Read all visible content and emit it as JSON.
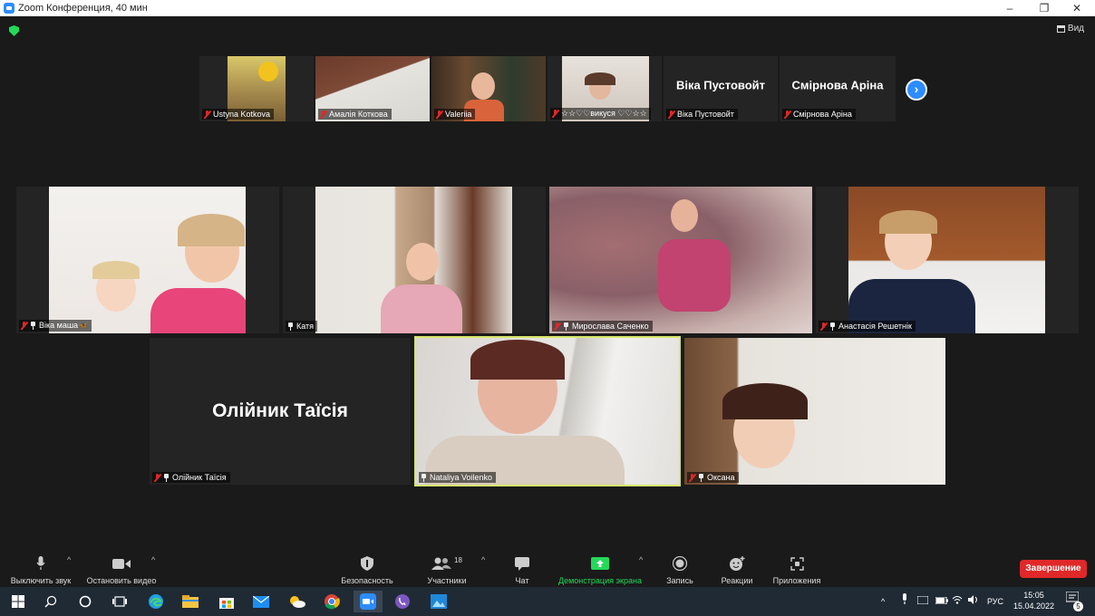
{
  "window": {
    "title": "Zoom Конференция, 40 мин",
    "minimize": "–",
    "maximize": "❐",
    "close": "✕"
  },
  "top": {
    "view_label": "Вид"
  },
  "strip": [
    {
      "name": "Ustyna Kotkova",
      "muted": true
    },
    {
      "name": "Амалія Коткова",
      "muted": true
    },
    {
      "name": "Valeriia",
      "muted": true
    },
    {
      "name": "☆☆♡♡викуся ♡♡☆☆",
      "muted": true
    },
    {
      "name": "Віка Пустовойт",
      "muted": true,
      "big": "Віка Пустовойт"
    },
    {
      "name": "Смірнова Аріна",
      "muted": true,
      "big": "Смірнова Аріна"
    }
  ],
  "next_page_icon": "›",
  "grid": [
    {
      "name": "Віка маша🦋",
      "muted": true
    },
    {
      "name": "Катя",
      "muted": false
    },
    {
      "name": "Мирослава Саченко",
      "muted": true
    },
    {
      "name": "Анастасія Решетнік",
      "muted": true
    },
    {
      "name": "Олійник Таїсія",
      "muted": true,
      "big": "Олійник Таїсія"
    },
    {
      "name": "Nataliya Voilenko",
      "muted": false
    },
    {
      "name": "Оксана",
      "muted": true
    }
  ],
  "toolbar": {
    "mute": "Выключить звук",
    "video": "Остановить видео",
    "security": "Безопасность",
    "participants": "Участники",
    "participants_count": "18",
    "chat": "Чат",
    "share": "Демонстрация экрана",
    "record": "Запись",
    "reactions": "Реакции",
    "apps": "Приложения",
    "end": "Завершение"
  },
  "taskbar": {
    "lang": "РУС",
    "time": "15:05",
    "date": "15.04.2022",
    "notif_count": "5"
  },
  "colors": {
    "accent": "#2d8cff",
    "share_green": "#23d959",
    "end_red": "#e02828",
    "active_speaker": "#d7e66a"
  }
}
